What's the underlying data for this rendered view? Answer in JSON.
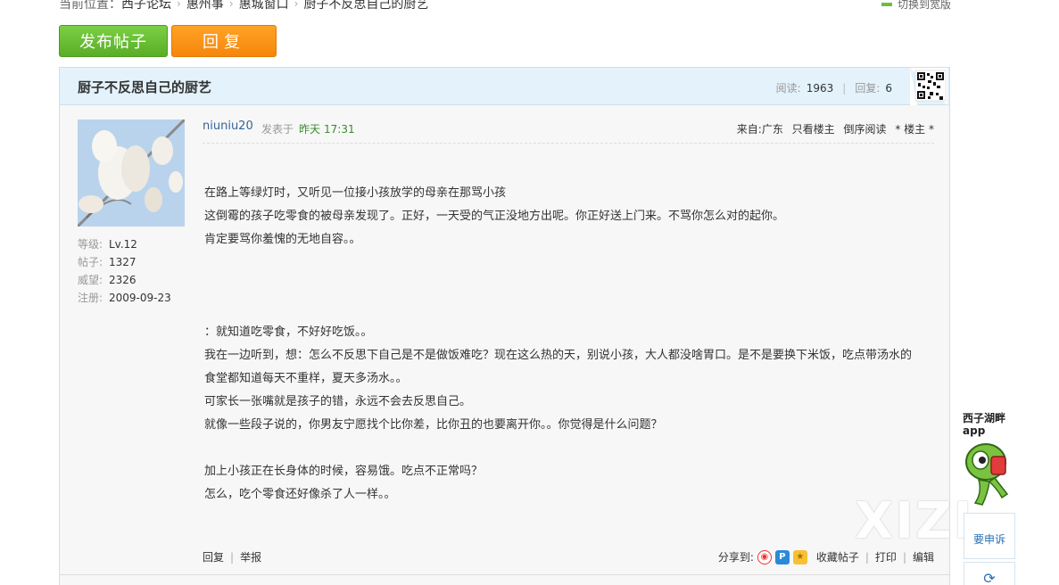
{
  "breadcrumb": {
    "label": "当前位置：",
    "items": [
      "西子论坛",
      "惠州事",
      "惠城窗口",
      "厨子不反思自己的厨艺"
    ]
  },
  "switch_wide": "切换到宽版",
  "buttons": {
    "post": "发布帖子",
    "reply": "回复"
  },
  "thread": {
    "title": "厨子不反思自己的厨艺",
    "read_label": "阅读:",
    "read_count": "1963",
    "reply_label": "回复:",
    "reply_count": "6"
  },
  "author": {
    "name": "niuniu20",
    "posted_label": "发表于",
    "posted_day": "昨天",
    "posted_time": "17:31",
    "info": [
      {
        "k": "等级:",
        "v": "Lv.12"
      },
      {
        "k": "帖子:",
        "v": "1327"
      },
      {
        "k": "威望:",
        "v": "2326"
      },
      {
        "k": "注册:",
        "v": "2009-09-23"
      }
    ]
  },
  "post_tools": {
    "from": "来自:广东",
    "only_op": "只看楼主",
    "reverse": "倒序阅读",
    "floor": "* 楼主 *"
  },
  "content": [
    "在路上等绿灯时，又听见一位接小孩放学的母亲在那骂小孩",
    "这倒霉的孩子吃零食的被母亲发现了。正好，一天受的气正没地方出呢。你正好送上门来。不骂你怎么对的起你。",
    "肯定要骂你羞愧的无地自容。。",
    "",
    "",
    "",
    "：就知道吃零食，不好好吃饭。。",
    "我在一边听到，想：怎么不反思下自己是不是做饭难吃？现在这么热的天，别说小孩，大人都没啥胃口。是不是要换下米饭，吃点带汤水的",
    "食堂都知道每天不重样，夏天多汤水。。",
    "可家长一张嘴就是孩子的错，永远不会去反思自己。",
    "就像一些段子说的，你男友宁愿找个比你差，比你丑的也要离开你。。你觉得是什么问题？",
    "",
    "加上小孩正在长身体的时候，容易饿。吃点不正常吗？",
    "怎么，吃个零食还好像杀了人一样。。"
  ],
  "footer": {
    "reply": "回复",
    "report": "举报",
    "share_label": "分享到:",
    "favorite": "收藏帖子",
    "print": "打印",
    "edit": "编辑"
  },
  "side": {
    "app_line1": "西子湖畔",
    "app_line2": "app",
    "complain": "要申诉"
  },
  "watermark": "XIZI",
  "colors": {
    "post_button": "#5aae27",
    "reply_button": "#f5860b",
    "title_bar": "#e3f2fb",
    "author_link": "#336699"
  }
}
